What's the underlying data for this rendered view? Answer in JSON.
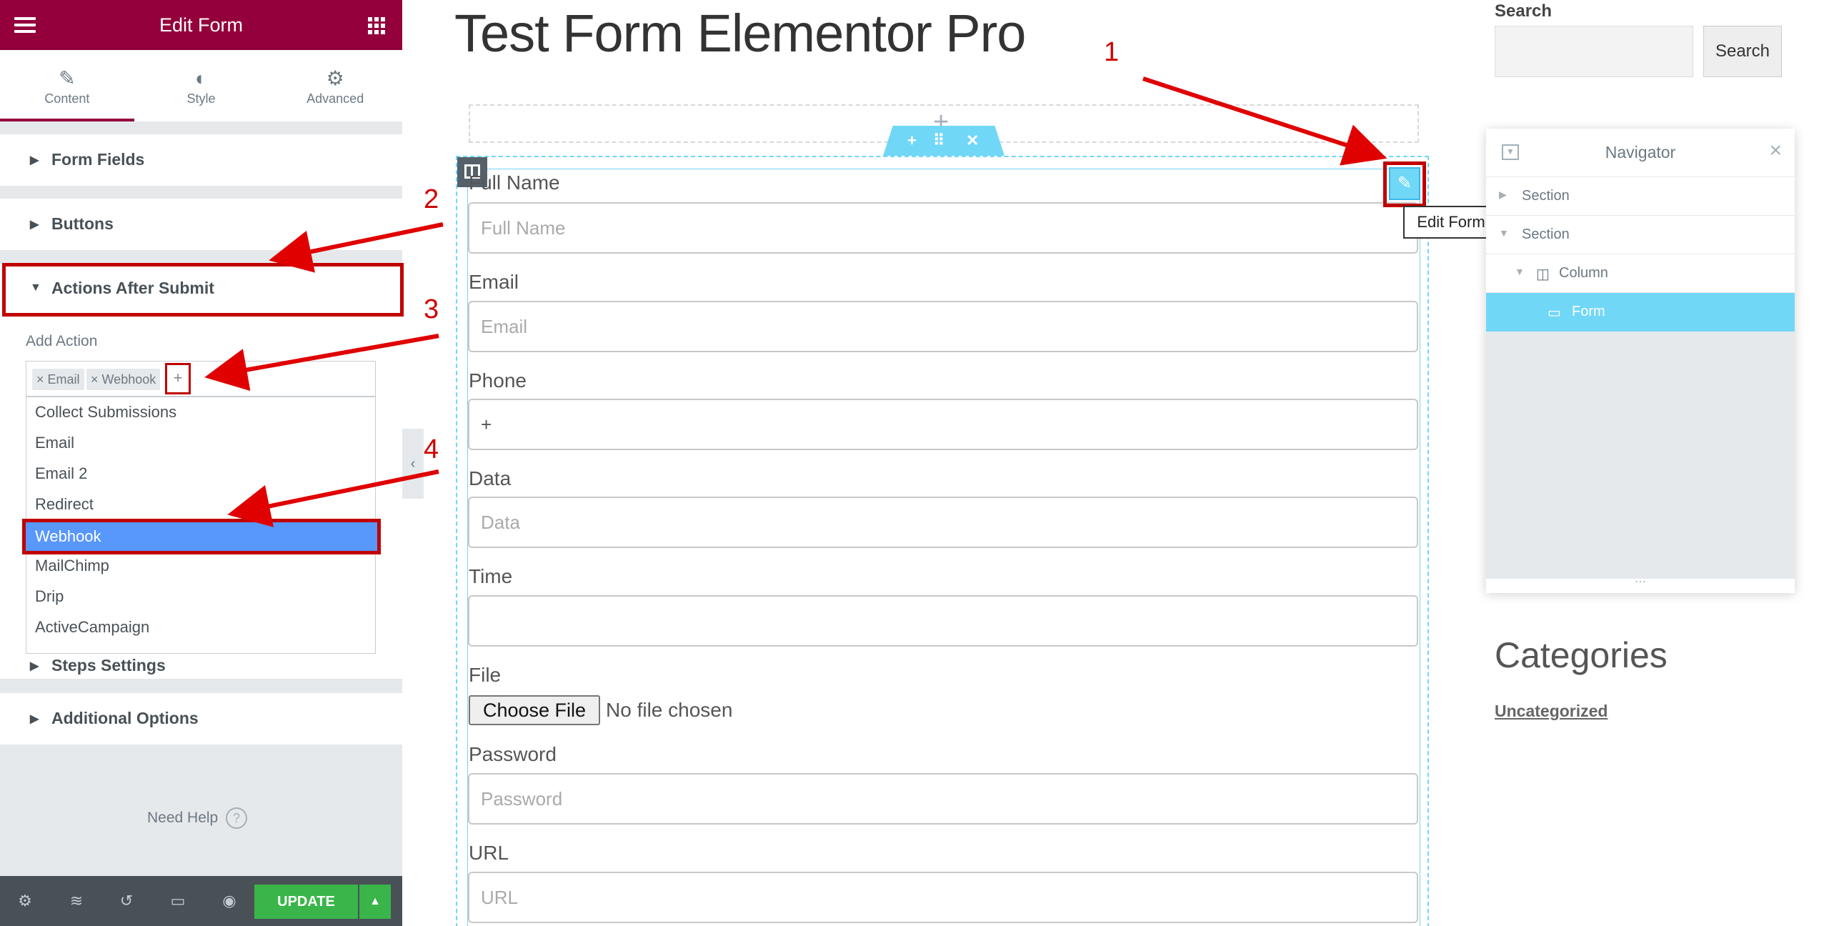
{
  "panel": {
    "title": "Edit Form",
    "tabs": [
      {
        "label": "Content",
        "icon": "pencil-icon"
      },
      {
        "label": "Style",
        "icon": "contrast-icon"
      },
      {
        "label": "Advanced",
        "icon": "gear-icon"
      }
    ],
    "sections": {
      "form_fields": "Form Fields",
      "buttons": "Buttons",
      "actions_after_submit": "Actions After Submit",
      "steps_settings": "Steps Settings",
      "additional_options": "Additional Options"
    },
    "add_action_label": "Add Action",
    "selected_actions": [
      "Email",
      "Webhook"
    ],
    "add_button": "+",
    "dropdown_options": [
      "Collect Submissions",
      "Email",
      "Email 2",
      "Redirect",
      "Webhook",
      "MailChimp",
      "Drip",
      "ActiveCampaign"
    ],
    "highlighted_option": "Webhook",
    "need_help": "Need Help",
    "help_icon": "?",
    "footer": {
      "update_label": "UPDATE",
      "icons": [
        "settings-icon",
        "layers-icon",
        "history-icon",
        "responsive-icon",
        "eye-icon"
      ]
    }
  },
  "page": {
    "title": "Test Form Elementor Pro",
    "form_fields": [
      {
        "label": "Full Name",
        "placeholder": "Full Name"
      },
      {
        "label": "Email",
        "placeholder": "Email"
      },
      {
        "label": "Phone",
        "placeholder": "+"
      },
      {
        "label": "Data",
        "placeholder": "Data"
      },
      {
        "label": "Time",
        "placeholder": ""
      }
    ],
    "file_field": {
      "label": "File",
      "button": "Choose File",
      "status": "No file chosen"
    },
    "password_field": {
      "label": "Password",
      "placeholder": "Password"
    },
    "url_field": {
      "label": "URL",
      "placeholder": "URL"
    },
    "edit_tooltip": "Edit Form"
  },
  "sidebar": {
    "search_heading": "Search",
    "search_button": "Search",
    "categories_heading": "Categories",
    "categories": [
      "Uncategorized"
    ]
  },
  "navigator": {
    "title": "Navigator",
    "items": [
      {
        "label": "Section"
      },
      {
        "label": "Section"
      },
      {
        "label": "Column"
      },
      {
        "label": "Form"
      }
    ],
    "active_item": "Form"
  },
  "annotations": {
    "steps": [
      "1",
      "2",
      "3",
      "4"
    ],
    "color": "#d00000"
  },
  "colors": {
    "brand": "#93003c",
    "accent": "#71d7f7",
    "update": "#39b54a",
    "highlight": "#c00000",
    "selected_option": "#5897fb"
  }
}
